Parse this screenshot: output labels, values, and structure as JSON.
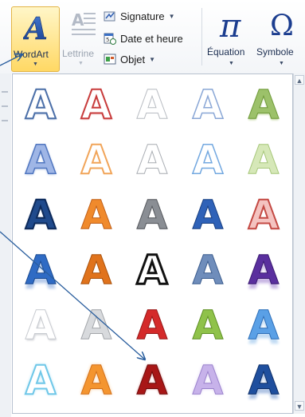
{
  "ribbon": {
    "wordart": {
      "label": "WordArt",
      "letter": "A"
    },
    "lettrine": {
      "label": "Lettrine"
    },
    "signature": {
      "label": "Signature"
    },
    "date_heure": {
      "label": "Date et heure"
    },
    "objet": {
      "label": "Objet"
    },
    "equation": {
      "label": "Équation",
      "glyph": "π"
    },
    "symbole": {
      "label": "Symbole",
      "glyph": "Ω"
    }
  },
  "gallery": {
    "glyph": "A",
    "rows": [
      [
        "blue-outline",
        "red-outline",
        "light-gray-outline",
        "pale-blue-outline",
        "green-gradient"
      ],
      [
        "blue-soft",
        "orange-outline",
        "gray-outline",
        "light-blue-outline",
        "light-green"
      ],
      [
        "dark-blue-solid",
        "orange-solid",
        "gray-metallic",
        "blue-gradient",
        "red-outline-double"
      ],
      [
        "blue-reflection",
        "orange-bold",
        "black-outline",
        "steel-blue",
        "purple-reflection"
      ],
      [
        "white-shadow",
        "gray-shadow",
        "red-gradient",
        "green-gradient-bold",
        "blue-reflection-2"
      ],
      [
        "light-blue-glow",
        "orange-glow",
        "dark-red-glow",
        "lavender-glow",
        "navy-reflection"
      ]
    ]
  },
  "colors": {
    "accent_highlight": "#ffd864",
    "arrow": "#2a5e9e"
  }
}
